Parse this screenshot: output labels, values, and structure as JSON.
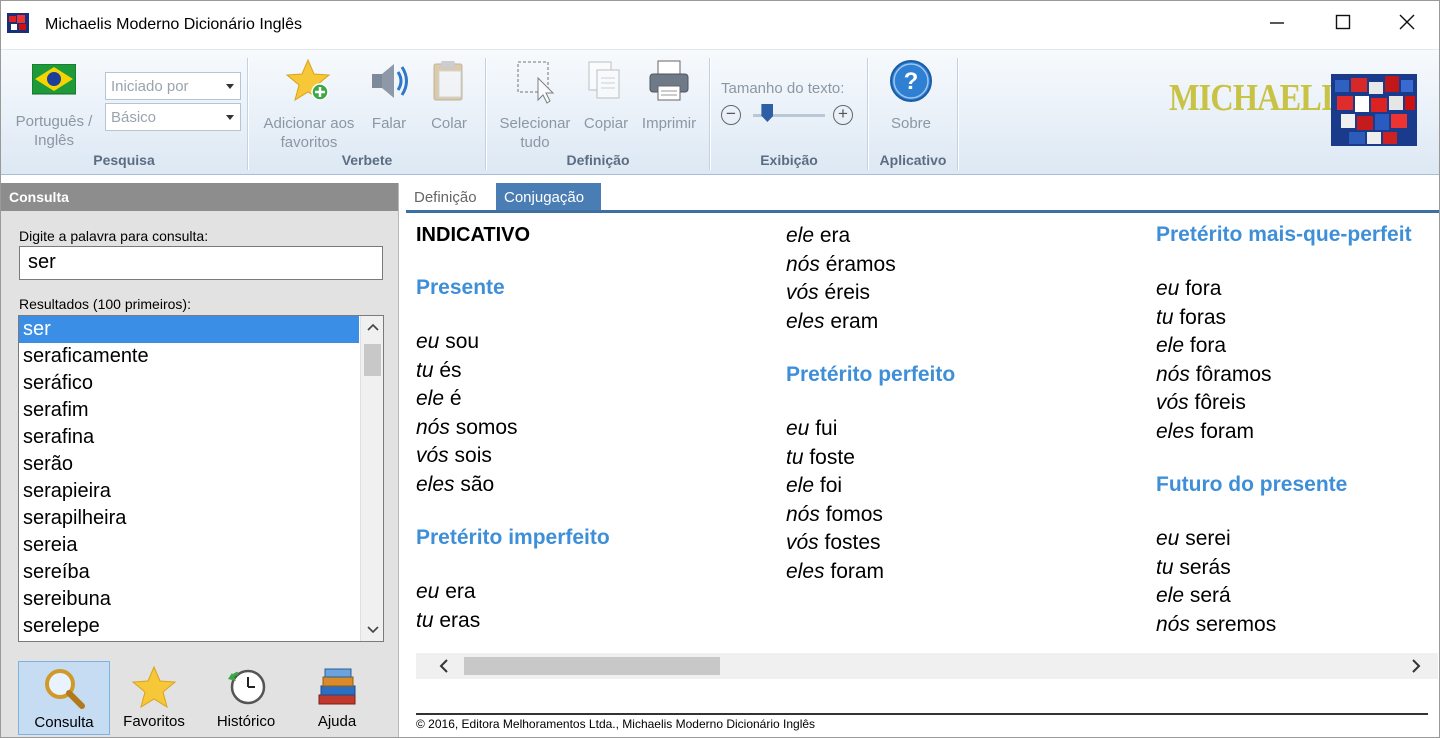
{
  "window": {
    "title": "Michaelis Moderno Dicionário Inglês"
  },
  "ribbon": {
    "pesquisa": {
      "lang_button": "Português / Inglês",
      "combo_search_mode": "Iniciado por",
      "combo_level": "Básico",
      "label": "Pesquisa"
    },
    "verbete": {
      "add_fav": "Adicionar aos favoritos",
      "speak": "Falar",
      "paste": "Colar",
      "label": "Verbete"
    },
    "definicao": {
      "select_all": "Selecionar tudo",
      "copy": "Copiar",
      "print": "Imprimir",
      "label": "Definição"
    },
    "exibicao": {
      "text_size": "Tamanho do texto:",
      "label": "Exibição",
      "text_size_level": 0.2
    },
    "aplicativo": {
      "about": "Sobre",
      "label": "Aplicativo"
    },
    "logo_text": "MICHAELIS"
  },
  "left": {
    "header": "Consulta",
    "search_label": "Digite a palavra para consulta:",
    "search_value": "ser",
    "results_label": "Resultados (100 primeiros):",
    "results": [
      "ser",
      "seraficamente",
      "seráfico",
      "serafim",
      "serafina",
      "serão",
      "serapieira",
      "serapilheira",
      "sereia",
      "sereíba",
      "sereibuna",
      "serelepe"
    ],
    "selected_index": 0,
    "nav": {
      "consulta": "Consulta",
      "favoritos": "Favoritos",
      "historico": "Histórico",
      "ajuda": "Ajuda"
    }
  },
  "right": {
    "tabs": [
      "Definição",
      "Conjugação"
    ],
    "active_tab": "Conjugação",
    "heading": "INDICATIVO",
    "col1": {
      "presente": "Presente",
      "presente_rows": [
        [
          "eu",
          "sou"
        ],
        [
          "tu",
          "és"
        ],
        [
          "ele",
          "é"
        ],
        [
          "nós",
          "somos"
        ],
        [
          "vós",
          "sois"
        ],
        [
          "eles",
          "são"
        ]
      ],
      "imperfeito": "Pretérito imperfeito",
      "imperfeito_rows": [
        [
          "eu",
          "era"
        ],
        [
          "tu",
          "eras"
        ]
      ]
    },
    "col2": {
      "imperfeito_cont": [
        [
          "ele",
          "era"
        ],
        [
          "nós",
          "éramos"
        ],
        [
          "vós",
          "éreis"
        ],
        [
          "eles",
          "eram"
        ]
      ],
      "perfeito": "Pretérito perfeito",
      "perfeito_rows": [
        [
          "eu",
          "fui"
        ],
        [
          "tu",
          "foste"
        ],
        [
          "ele",
          "foi"
        ],
        [
          "nós",
          "fomos"
        ],
        [
          "vós",
          "fostes"
        ],
        [
          "eles",
          "foram"
        ]
      ]
    },
    "col3": {
      "mais_que": "Pretérito mais-que-perfeit",
      "mais_que_rows": [
        [
          "eu",
          "fora"
        ],
        [
          "tu",
          "foras"
        ],
        [
          "ele",
          "fora"
        ],
        [
          "nós",
          "fôramos"
        ],
        [
          "vós",
          "fôreis"
        ],
        [
          "eles",
          "foram"
        ]
      ],
      "futuro": "Futuro do presente",
      "futuro_rows": [
        [
          "eu",
          "serei"
        ],
        [
          "tu",
          "serás"
        ],
        [
          "ele",
          "será"
        ],
        [
          "nós",
          "seremos"
        ]
      ]
    },
    "footer": "© 2016, Editora Melhoramentos Ltda., Michaelis Moderno Dicionário Inglês"
  }
}
